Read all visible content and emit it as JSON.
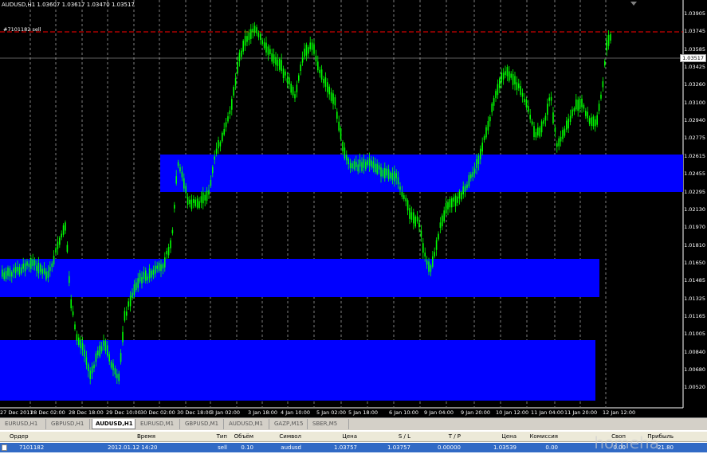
{
  "chart": {
    "header": "AUDUSD,H1  1.03607 1.03617 1.03470 1.03517",
    "order_label": "#7101182 sell",
    "current_price": "1.03517",
    "price_labels": [
      "1.03905",
      "1.03745",
      "1.03585",
      "1.03425",
      "1.03260",
      "1.03100",
      "1.02940",
      "1.02775",
      "1.02615",
      "1.02455",
      "1.02295",
      "1.02130",
      "1.01970",
      "1.01810",
      "1.01650",
      "1.01485",
      "1.01325",
      "1.01165",
      "1.01005",
      "1.00840",
      "1.00680",
      "1.00520"
    ],
    "time_labels": [
      "27 Dec 2011",
      "28 Dec 02:00",
      "28 Dec 18:00",
      "29 Dec 10:00",
      "30 Dec 02:00",
      "30 Dec 18:00",
      "3 Jan 02:00",
      "3 Jan 18:00",
      "4 Jan 10:00",
      "5 Jan 02:00",
      "5 Jan 18:00",
      "6 Jan 10:00",
      "9 Jan 04:00",
      "9 Jan 20:00",
      "10 Jan 12:00",
      "11 Jan 04:00",
      "11 Jan 20:00",
      "12 Jan 12:00"
    ],
    "colors": {
      "background": "#000000",
      "candles": "#00ff00",
      "zones": "#0000ff",
      "grid": "#808080",
      "sell_line": "#ff0000"
    }
  },
  "tabs": [
    "EURUSD,H1",
    "GBPUSD,H1",
    "AUDUSD,H1",
    "EURUSD,M1",
    "GBPUSD,M1",
    "AUDUSD,M1",
    "GAZP,M15",
    "SBER,M5"
  ],
  "active_tab": "AUDUSD,H1",
  "terminal": {
    "columns": [
      "Ордер",
      "Время",
      "Тип",
      "Объём",
      "Символ",
      "Цена",
      "S / L",
      "T / P",
      "Цена",
      "Комиссия",
      "Своп",
      "Прибыль"
    ],
    "row": [
      "7101182",
      "2012.01.12 14:20",
      "sell",
      "0.10",
      "audusd",
      "1.03757",
      "1.03757",
      "0.00000",
      "1.03539",
      "0.00",
      "0.00",
      "21.80"
    ]
  },
  "watermark": "homeha"
}
